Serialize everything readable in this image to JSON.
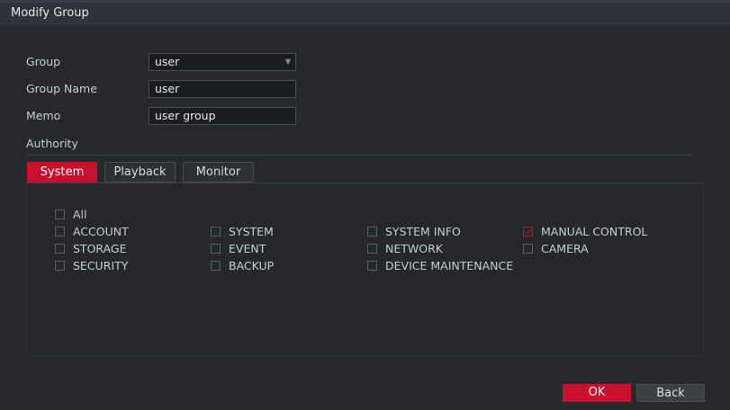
{
  "dialog": {
    "title": "Modify Group"
  },
  "form": {
    "group_label": "Group",
    "group_value": "user",
    "group_name_label": "Group Name",
    "group_name_value": "user",
    "memo_label": "Memo",
    "memo_value": "user group"
  },
  "authority": {
    "label": "Authority",
    "tabs": [
      {
        "label": "System",
        "active": true
      },
      {
        "label": "Playback",
        "active": false
      },
      {
        "label": "Monitor",
        "active": false
      }
    ],
    "all_label": "All",
    "permissions": [
      {
        "label": "ACCOUNT",
        "checked": false
      },
      {
        "label": "SYSTEM",
        "checked": false
      },
      {
        "label": "SYSTEM INFO",
        "checked": false
      },
      {
        "label": "MANUAL CONTROL",
        "checked": true
      },
      {
        "label": "STORAGE",
        "checked": false
      },
      {
        "label": "EVENT",
        "checked": false
      },
      {
        "label": "NETWORK",
        "checked": false
      },
      {
        "label": "CAMERA",
        "checked": false
      },
      {
        "label": "SECURITY",
        "checked": false
      },
      {
        "label": "BACKUP",
        "checked": false
      },
      {
        "label": "DEVICE MAINTENANCE",
        "checked": false
      }
    ]
  },
  "buttons": {
    "ok_label": "OK",
    "back_label": "Back"
  },
  "colors": {
    "accent": "#c8102e",
    "background": "#24262b"
  }
}
